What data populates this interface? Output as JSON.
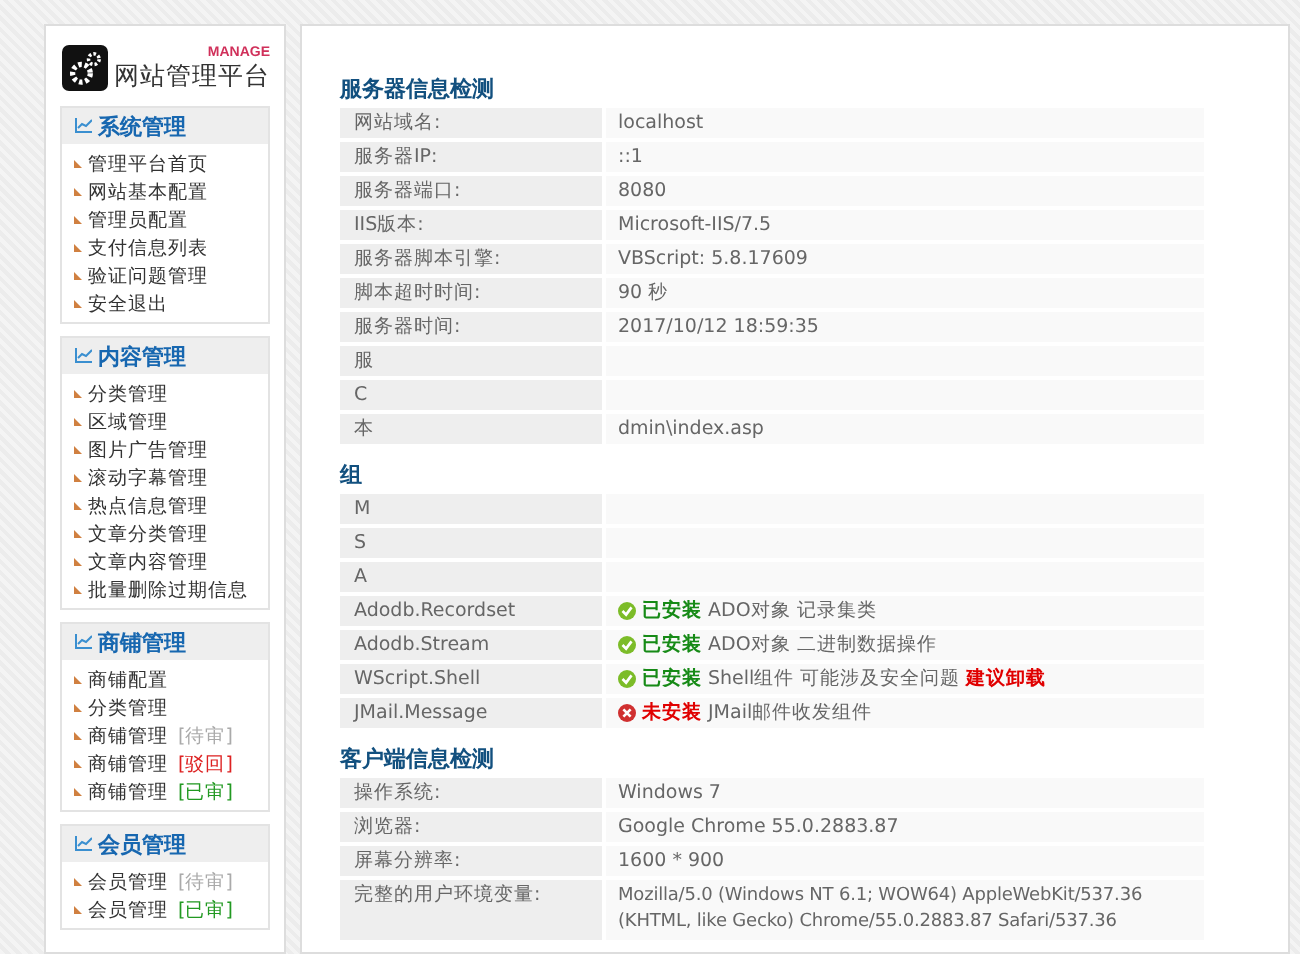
{
  "logo": {
    "badge": "MANAGE",
    "title": "网站管理平台"
  },
  "sidebar": [
    {
      "title": "系统管理",
      "items": [
        {
          "label": "管理平台首页"
        },
        {
          "label": "网站基本配置"
        },
        {
          "label": "管理员配置"
        },
        {
          "label": "支付信息列表"
        },
        {
          "label": "验证问题管理"
        },
        {
          "label": "安全退出"
        }
      ]
    },
    {
      "title": "内容管理",
      "items": [
        {
          "label": "分类管理"
        },
        {
          "label": "区域管理"
        },
        {
          "label": "图片广告管理"
        },
        {
          "label": "滚动字幕管理"
        },
        {
          "label": "热点信息管理"
        },
        {
          "label": "文章分类管理"
        },
        {
          "label": "文章内容管理"
        },
        {
          "label": "批量删除过期信息"
        }
      ]
    },
    {
      "title": "商铺管理",
      "items": [
        {
          "label": "商铺配置"
        },
        {
          "label": "分类管理"
        },
        {
          "label": "商铺管理",
          "tag": "[待审]",
          "color": "#aaaaaa"
        },
        {
          "label": "商铺管理",
          "tag": "[驳回]",
          "color": "#dd2222"
        },
        {
          "label": "商铺管理",
          "tag": "[已审]",
          "color": "#229922"
        }
      ]
    },
    {
      "title": "会员管理",
      "items": [
        {
          "label": "会员管理",
          "tag": "[待审]",
          "color": "#aaaaaa"
        },
        {
          "label": "会员管理",
          "tag": "[已审]",
          "color": "#229922"
        }
      ]
    }
  ],
  "sections": [
    {
      "title": "服务器信息检测",
      "rows": [
        {
          "label": "网站域名:",
          "value": "localhost"
        },
        {
          "label": "服务器IP:",
          "value": "::1"
        },
        {
          "label": "服务器端口:",
          "value": "8080"
        },
        {
          "label": "IIS版本:",
          "value": "Microsoft-IIS/7.5"
        },
        {
          "label": "服务器脚本引擎:",
          "value": "VBScript: 5.8.17609"
        },
        {
          "label": "脚本超时时间:",
          "value": "90 秒"
        },
        {
          "label": "服务器时间:",
          "value": "2017/10/12 18:59:35"
        },
        {
          "label": "服"
        },
        {
          "label": "C"
        },
        {
          "label": "本",
          "value": "dmin\\index.asp"
        }
      ]
    },
    {
      "title": "组",
      "rows": [
        {
          "label": "M"
        },
        {
          "label": "S"
        },
        {
          "label": "A"
        },
        {
          "label": "Adodb.Recordset",
          "status": {
            "installed": true,
            "text": "已安装"
          },
          "value": "ADO对象 记录集类"
        },
        {
          "label": "Adodb.Stream",
          "status": {
            "installed": true,
            "text": "已安装"
          },
          "value": "ADO对象 二进制数据操作"
        },
        {
          "label": "WScript.Shell",
          "status": {
            "installed": true,
            "text": "已安装"
          },
          "value": "Shell组件 可能涉及安全问题",
          "warning": "建议卸载"
        },
        {
          "label": "JMail.Message",
          "status": {
            "installed": false,
            "text": "未安装"
          },
          "value": "JMail邮件收发组件"
        }
      ]
    },
    {
      "title": "客户端信息检测",
      "rows": [
        {
          "label": "操作系统:",
          "value": "Windows 7"
        },
        {
          "label": "浏览器:",
          "value": "Google Chrome 55.0.2883.87"
        },
        {
          "label": "屏幕分辨率:",
          "value": "1600 * 900"
        },
        {
          "label": "完整的用户环境变量:",
          "value": "Mozilla/5.0 (Windows NT 6.1; WOW64) AppleWebKit/537.36 (KHTML, like Gecko) Chrome/55.0.2883.87 Safari/537.36"
        }
      ]
    }
  ]
}
